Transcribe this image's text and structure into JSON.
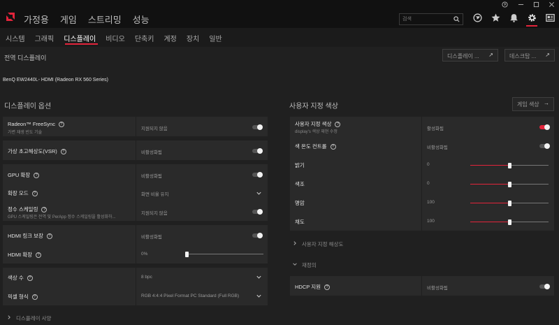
{
  "colors": {
    "accent": "#e3243b",
    "topbar": "#111111",
    "panel": "#2a2a2a",
    "background": "#202020"
  },
  "app": {
    "main_nav": [
      "가정용",
      "게임",
      "스트리밍",
      "성능"
    ],
    "search": {
      "placeholder": "검색"
    },
    "icons": [
      "globe-icon",
      "star-icon",
      "bell-icon",
      "gear-icon",
      "news-icon"
    ]
  },
  "subnav": {
    "items": [
      "시스템",
      "그래픽",
      "디스플레이",
      "비디오",
      "단축키",
      "계정",
      "장치",
      "일반"
    ],
    "active": "디스플레이"
  },
  "page": {
    "all_displays": "전역 디스플레이",
    "btn_display": "디스플레이 ...",
    "btn_desktop": "데스크탑 ...",
    "monitor_name": "BenQ EW2440L- HDMI (Radeon RX 560 Series)"
  },
  "display_options": {
    "title": "디스플레이 옵션",
    "freesync": {
      "label": "Radeon™ FreeSync",
      "sub": "가변 재생 빈도 기술",
      "value": "지원되지 않음"
    },
    "vsr": {
      "label": "가상 초고해상도(VSR)",
      "value": "비활성화됨"
    },
    "gpu_scaling": {
      "label": "GPU 확장",
      "value": "비활성화됨"
    },
    "scaling_mode": {
      "label": "확장 모드",
      "value": "화면 비율 유지"
    },
    "integer_scaling": {
      "label": "정수 스케일링",
      "sub": "GPU 스케일링은 전역 및 PerApp 정수 스케일링을 활성화하...",
      "value": "지원되지 않음"
    },
    "hdmi_link": {
      "label": "HDMI 링크 보장",
      "value": "비활성화됨"
    },
    "hdmi_scaling": {
      "label": "HDMI 확장",
      "value": "0%",
      "level": 0
    },
    "color_depth": {
      "label": "색상 수",
      "value": "8 bpc"
    },
    "pixel_format": {
      "label": "픽셀 형식",
      "value": "RGB 4:4:4 Pixel Format PC Standard (Full RGB)"
    },
    "display_specs": "디스플레이 사양"
  },
  "custom_color": {
    "title": "사용자 지정 색상",
    "game_colors_btn": "게임 색상",
    "custom_color": {
      "label": "사용자 지정 색상",
      "sub": "display's 색상 재현 수정",
      "value": "활성화됨"
    },
    "color_temp": {
      "label": "색 온도 컨트롤",
      "value": "비활성화됨"
    },
    "brightness": {
      "label": "밝기",
      "value": "0",
      "level": 0.5
    },
    "hue": {
      "label": "색조",
      "value": "0",
      "level": 0.5
    },
    "contrast": {
      "label": "명암",
      "value": "100",
      "level": 0.5
    },
    "saturation": {
      "label": "채도",
      "value": "100",
      "level": 0.5
    },
    "custom_resolution": "사용자 지정 해상도",
    "overrides": "재정의",
    "hdcp": {
      "label": "HDCP 지원",
      "value": "비활성화됨"
    }
  }
}
